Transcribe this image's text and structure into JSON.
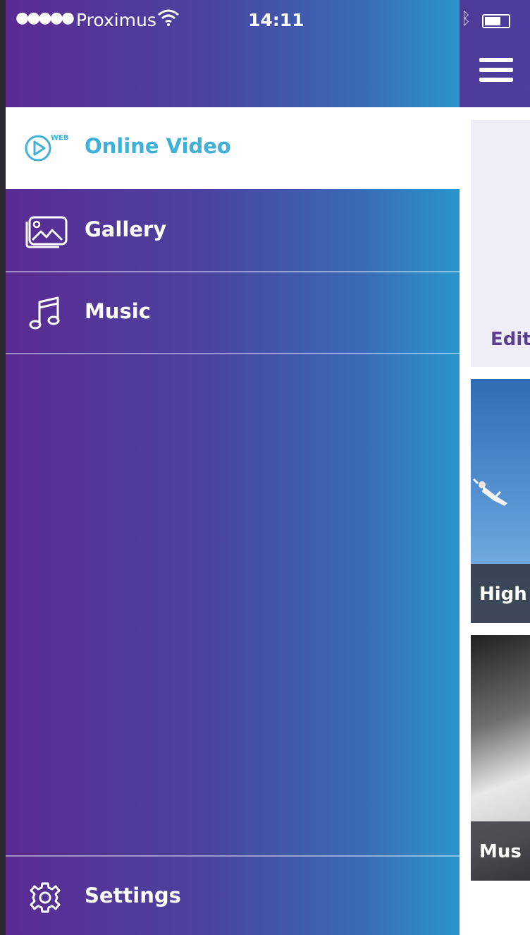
{
  "status_bar": {
    "signal_dots": "●●●●●",
    "carrier": "Proximus",
    "time": "14:11",
    "bluetooth": "ᛒ"
  },
  "drawer": {
    "items": [
      {
        "label": "Online Video",
        "icon": "web-video-icon",
        "active": true
      },
      {
        "label": "Gallery",
        "icon": "gallery-icon",
        "active": false
      },
      {
        "label": "Music",
        "icon": "music-note-icon",
        "active": false
      }
    ],
    "footer": {
      "label": "Settings",
      "icon": "gear-icon"
    }
  },
  "main": {
    "menu_icon": "hamburger-icon",
    "cards": [
      {
        "caption": "Edit"
      },
      {
        "caption": "High"
      },
      {
        "caption": "Mus"
      }
    ]
  },
  "colors": {
    "drawer_gradient_start": "#5a2b93",
    "drawer_gradient_end": "#2a95cc",
    "active_label": "#3fb0d8",
    "header_purple": "#4f3a98"
  }
}
